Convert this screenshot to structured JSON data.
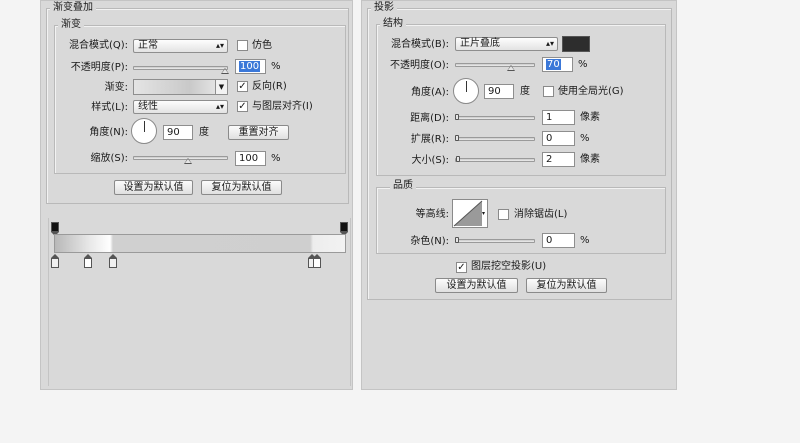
{
  "gradient_overlay": {
    "panel_title": "渐变叠加",
    "section_title": "渐变",
    "blend_mode_label": "混合模式(Q):",
    "blend_mode_value": "正常",
    "dither_label": "仿色",
    "dither_checked": false,
    "opacity_label": "不透明度(P):",
    "opacity_value": "100",
    "opacity_unit": "%",
    "gradient_label": "渐变:",
    "reverse_label": "反向(R)",
    "reverse_checked": true,
    "style_label": "样式(L):",
    "style_value": "线性",
    "align_label": "与图层对齐(I)",
    "align_checked": true,
    "angle_label": "角度(N):",
    "angle_value": "90",
    "angle_unit": "度",
    "reset_alignment_label": "重置对齐",
    "scale_label": "缩放(S):",
    "scale_value": "100",
    "scale_unit": "%",
    "make_default_label": "设置为默认值",
    "reset_default_label": "复位为默认值"
  },
  "drop_shadow": {
    "panel_title": "投影",
    "structure_title": "结构",
    "blend_mode_label": "混合模式(B):",
    "blend_mode_value": "正片叠底",
    "shadow_color": "#2d2d2d",
    "opacity_label": "不透明度(O):",
    "opacity_value": "70",
    "opacity_unit": "%",
    "angle_label": "角度(A):",
    "angle_value": "90",
    "angle_unit": "度",
    "global_light_label": "使用全局光(G)",
    "global_light_checked": false,
    "distance_label": "距离(D):",
    "distance_value": "1",
    "distance_unit": "像素",
    "spread_label": "扩展(R):",
    "spread_value": "0",
    "spread_unit": "%",
    "size_label": "大小(S):",
    "size_value": "2",
    "size_unit": "像素",
    "quality_title": "品质",
    "contour_label": "等高线:",
    "antialias_label": "消除锯齿(L)",
    "antialias_checked": false,
    "noise_label": "杂色(N):",
    "noise_value": "0",
    "noise_unit": "%",
    "knockout_label": "图层挖空投影(U)",
    "knockout_checked": true,
    "make_default_label": "设置为默认值",
    "reset_default_label": "复位为默认值"
  },
  "sliders": {
    "go_opacity": 1.0,
    "go_scale": 0.5,
    "ds_opacity": 0.7,
    "ds_distance": 0.0,
    "ds_spread": 0.0,
    "ds_size": 0.02,
    "ds_noise": 0.0
  },
  "icons": [
    "dropdown-arrow-icon",
    "angle-dial-icon",
    "gradient-stop-icon",
    "contour-curve-icon",
    "checkmark-icon"
  ]
}
